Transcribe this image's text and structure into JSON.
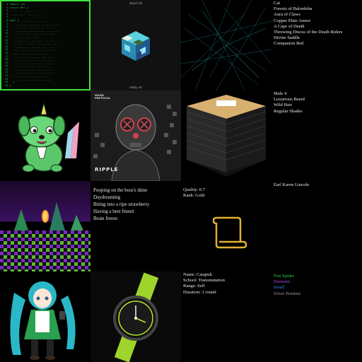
{
  "tiles": {
    "cube_viewer": {
      "title": "xbox3.stl",
      "footer": "lobby xd"
    },
    "item_list": {
      "items": [
        "Cat",
        "Forests of Balordoba",
        "Aura of Claws",
        "Copper Plate Armor",
        "A Cape of Death",
        "Throwing Discus of the Death Riders",
        "Divine Saddle",
        "Companion Bed"
      ]
    },
    "album": {
      "label_top": "MOON PROTOCOL",
      "title": "RIPPLE"
    },
    "traits": {
      "items": [
        "Male 4",
        "Luxurious Beard",
        "Wild Hair",
        "Regular Shades"
      ]
    },
    "name_card": {
      "name": "Earl Karen Lincoln"
    },
    "dreams": {
      "items": [
        "Pooping on the boss's dime",
        "Daydreaming",
        "Biting into a ripe strawberry",
        "Having a best friend",
        "Brain freeze"
      ]
    },
    "scroll_card": {
      "quality": "Quality: 0.7",
      "rank": "Rank: Gold"
    },
    "spell": {
      "name": "Name: Catapult",
      "school": "School: Transmutation",
      "range": "Range: Self",
      "duration": "Duration: 1 round"
    },
    "loot": {
      "items": [
        {
          "text": "Fire Spider",
          "color": "#2ad24a"
        },
        {
          "text": "Demonic",
          "color": "#b04be0"
        },
        {
          "text": "Small",
          "color": "#3a8cf0"
        },
        {
          "text": "Silver Pendant",
          "color": "#9a9a9a"
        }
      ]
    }
  },
  "colors": {
    "terminal_border": "#3fe03a",
    "scroll_gold": "#e0b030",
    "watch_green": "#b6e830"
  }
}
